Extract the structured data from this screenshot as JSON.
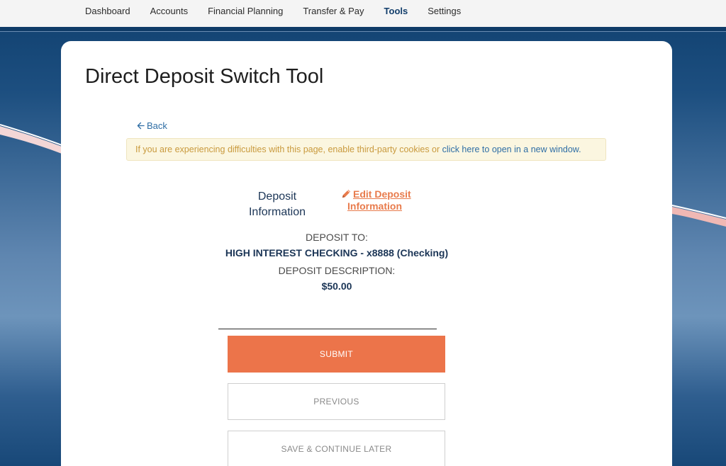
{
  "nav": {
    "items": [
      {
        "label": "Dashboard"
      },
      {
        "label": "Accounts"
      },
      {
        "label": "Financial Planning"
      },
      {
        "label": "Transfer & Pay"
      },
      {
        "label": "Tools"
      },
      {
        "label": "Settings"
      }
    ],
    "active": "Tools"
  },
  "page": {
    "title": "Direct Deposit Switch Tool"
  },
  "back": {
    "label": "Back",
    "icon": "arrow-left-icon"
  },
  "notice": {
    "text": "If you are experiencing difficulties with this page, enable third-party cookies or ",
    "link_text": "click here to open in a new window."
  },
  "deposit": {
    "heading_line1": "Deposit",
    "heading_line2": "Information",
    "edit_line1": "Edit Deposit",
    "edit_line2": "Information",
    "edit_icon": "pencil-icon",
    "to_label": "DEPOSIT TO:",
    "to_value": "HIGH INTEREST CHECKING - x8888 (Checking)",
    "desc_label": "DEPOSIT DESCRIPTION:",
    "desc_value": "$50.00"
  },
  "buttons": {
    "submit": "SUBMIT",
    "previous": "PREVIOUS",
    "save": "SAVE & CONTINUE LATER"
  },
  "colors": {
    "accent": "#ec744a",
    "navy": "#1b3556",
    "link": "#2f6ea5",
    "notice_bg": "#fbf6e0",
    "notice_text": "#c99a3e"
  }
}
